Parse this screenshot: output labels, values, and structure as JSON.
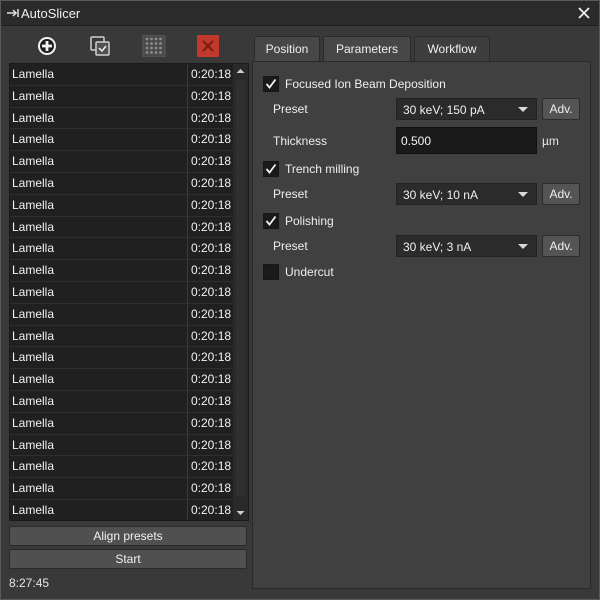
{
  "window": {
    "title": "AutoSlicer"
  },
  "toolbar": {
    "buttons": [
      {
        "icon": "add-icon"
      },
      {
        "icon": "duplicate-icon"
      },
      {
        "icon": "grid-icon"
      },
      {
        "icon": "delete-icon"
      }
    ]
  },
  "list": {
    "rows": [
      {
        "name": "Lamella",
        "time": "0:20:18"
      },
      {
        "name": "Lamella",
        "time": "0:20:18"
      },
      {
        "name": "Lamella",
        "time": "0:20:18"
      },
      {
        "name": "Lamella",
        "time": "0:20:18"
      },
      {
        "name": "Lamella",
        "time": "0:20:18"
      },
      {
        "name": "Lamella",
        "time": "0:20:18"
      },
      {
        "name": "Lamella",
        "time": "0:20:18"
      },
      {
        "name": "Lamella",
        "time": "0:20:18"
      },
      {
        "name": "Lamella",
        "time": "0:20:18"
      },
      {
        "name": "Lamella",
        "time": "0:20:18"
      },
      {
        "name": "Lamella",
        "time": "0:20:18"
      },
      {
        "name": "Lamella",
        "time": "0:20:18"
      },
      {
        "name": "Lamella",
        "time": "0:20:18"
      },
      {
        "name": "Lamella",
        "time": "0:20:18"
      },
      {
        "name": "Lamella",
        "time": "0:20:18"
      },
      {
        "name": "Lamella",
        "time": "0:20:18"
      },
      {
        "name": "Lamella",
        "time": "0:20:18"
      },
      {
        "name": "Lamella",
        "time": "0:20:18"
      },
      {
        "name": "Lamella",
        "time": "0:20:18"
      },
      {
        "name": "Lamella",
        "time": "0:20:18"
      },
      {
        "name": "Lamella",
        "time": "0:20:18"
      }
    ]
  },
  "buttons": {
    "align_presets": "Align presets",
    "start": "Start"
  },
  "status": {
    "clock": "8:27:45"
  },
  "tabs": [
    {
      "label": "Position",
      "active": false
    },
    {
      "label": "Parameters",
      "active": false
    },
    {
      "label": "Workflow",
      "active": true
    }
  ],
  "workflow": {
    "fib": {
      "label": "Focused Ion Beam Deposition",
      "checked": true
    },
    "fib_preset": {
      "label": "Preset",
      "value": "30 keV; 150 pA",
      "adv": "Adv."
    },
    "thickness": {
      "label": "Thickness",
      "value": "0.500",
      "unit": "µm"
    },
    "trench": {
      "label": "Trench milling",
      "checked": true
    },
    "trench_preset": {
      "label": "Preset",
      "value": "30 keV; 10 nA",
      "adv": "Adv."
    },
    "polishing": {
      "label": "Polishing",
      "checked": true
    },
    "polishing_preset": {
      "label": "Preset",
      "value": "30 keV; 3 nA",
      "adv": "Adv."
    },
    "undercut": {
      "label": "Undercut",
      "checked": false
    }
  },
  "colors": {
    "accent_delete": "#c0392b",
    "background": "#393939",
    "list_bg": "#202020"
  }
}
